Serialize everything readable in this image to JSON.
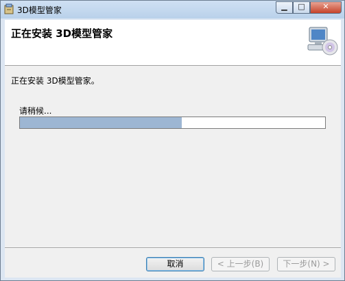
{
  "window": {
    "title": "3D模型管家"
  },
  "header": {
    "title": "正在安装 3D模型管家"
  },
  "content": {
    "status": "正在安装 3D模型管家。",
    "wait": "请稍候...",
    "progress": 0.53
  },
  "footer": {
    "cancel": "取消",
    "back": "< 上一步(B)",
    "next": "下一步(N) >"
  },
  "icons": {
    "app": "installer-icon",
    "header": "computer-disc-icon"
  }
}
